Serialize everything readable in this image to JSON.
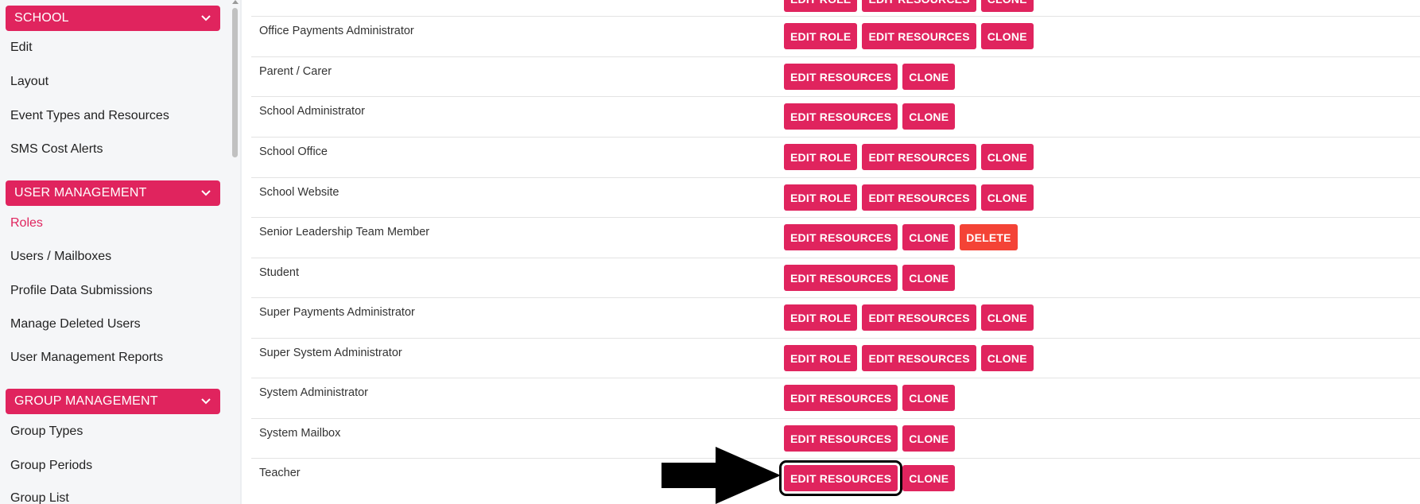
{
  "sidebar": {
    "sections": [
      {
        "label": "SCHOOL",
        "items": [
          "Edit",
          "Layout",
          "Event Types and Resources",
          "SMS Cost Alerts"
        ]
      },
      {
        "label": "USER MANAGEMENT",
        "items": [
          "Roles",
          "Users / Mailboxes",
          "Profile Data Submissions",
          "Manage Deleted Users",
          "User Management Reports"
        ]
      },
      {
        "label": "GROUP MANAGEMENT",
        "items": [
          "Group Types",
          "Group Periods",
          "Group List"
        ]
      }
    ],
    "active_item": "Roles"
  },
  "buttons": {
    "edit_role": "EDIT ROLE",
    "edit_resources": "EDIT RESOURCES",
    "clone": "CLONE",
    "delete": "DELETE"
  },
  "roles": [
    {
      "name": "Office Payments Administrator"
    },
    {
      "name": "Parent / Carer"
    },
    {
      "name": "School Administrator"
    },
    {
      "name": "School Office"
    },
    {
      "name": "School Website"
    },
    {
      "name": "Senior Leadership Team Member"
    },
    {
      "name": "Student"
    },
    {
      "name": "Super Payments Administrator"
    },
    {
      "name": "Super System Administrator"
    },
    {
      "name": "System Administrator"
    },
    {
      "name": "System Mailbox"
    },
    {
      "name": "Teacher"
    }
  ],
  "colors": {
    "accent": "#e0245e",
    "delete": "#f44336",
    "sidebar_bg": "#f5f6f8"
  }
}
